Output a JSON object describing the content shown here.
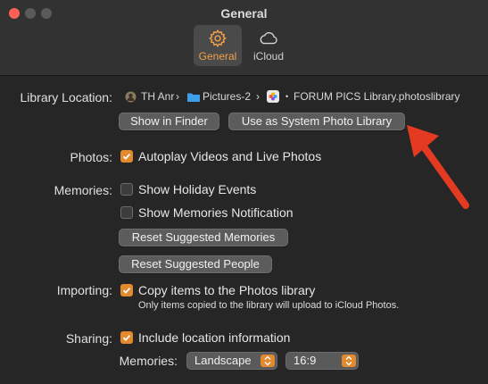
{
  "window": {
    "title": "General",
    "tabs": [
      {
        "label": "General",
        "icon": "gear-icon",
        "active": true
      },
      {
        "label": "iCloud",
        "icon": "cloud-icon",
        "active": false
      }
    ]
  },
  "library_location": {
    "label": "Library Location:",
    "path": {
      "user": "TH Anr",
      "folder": "Pictures-2",
      "library": "FORUM PICS Library.photoslibrary"
    },
    "show_in_finder": "Show in Finder",
    "use_as_system": "Use as System Photo Library"
  },
  "photos": {
    "label": "Photos:",
    "autoplay": {
      "text": "Autoplay Videos and Live Photos",
      "checked": true
    }
  },
  "memories": {
    "label": "Memories:",
    "holiday": {
      "text": "Show Holiday Events",
      "checked": false
    },
    "notification": {
      "text": "Show Memories Notification",
      "checked": false
    },
    "reset_memories": "Reset Suggested Memories",
    "reset_people": "Reset Suggested People"
  },
  "importing": {
    "label": "Importing:",
    "copy": {
      "text": "Copy items to the Photos library",
      "checked": true
    },
    "note": "Only items copied to the library will upload to iCloud Photos."
  },
  "sharing": {
    "label": "Sharing:",
    "location": {
      "text": "Include location information",
      "checked": true
    },
    "memories_label": "Memories:",
    "orientation": "Landscape",
    "aspect": "16:9"
  },
  "colors": {
    "accent": "#e38a2e",
    "annotation_arrow": "#e53a22",
    "window_bg": "#262626"
  }
}
